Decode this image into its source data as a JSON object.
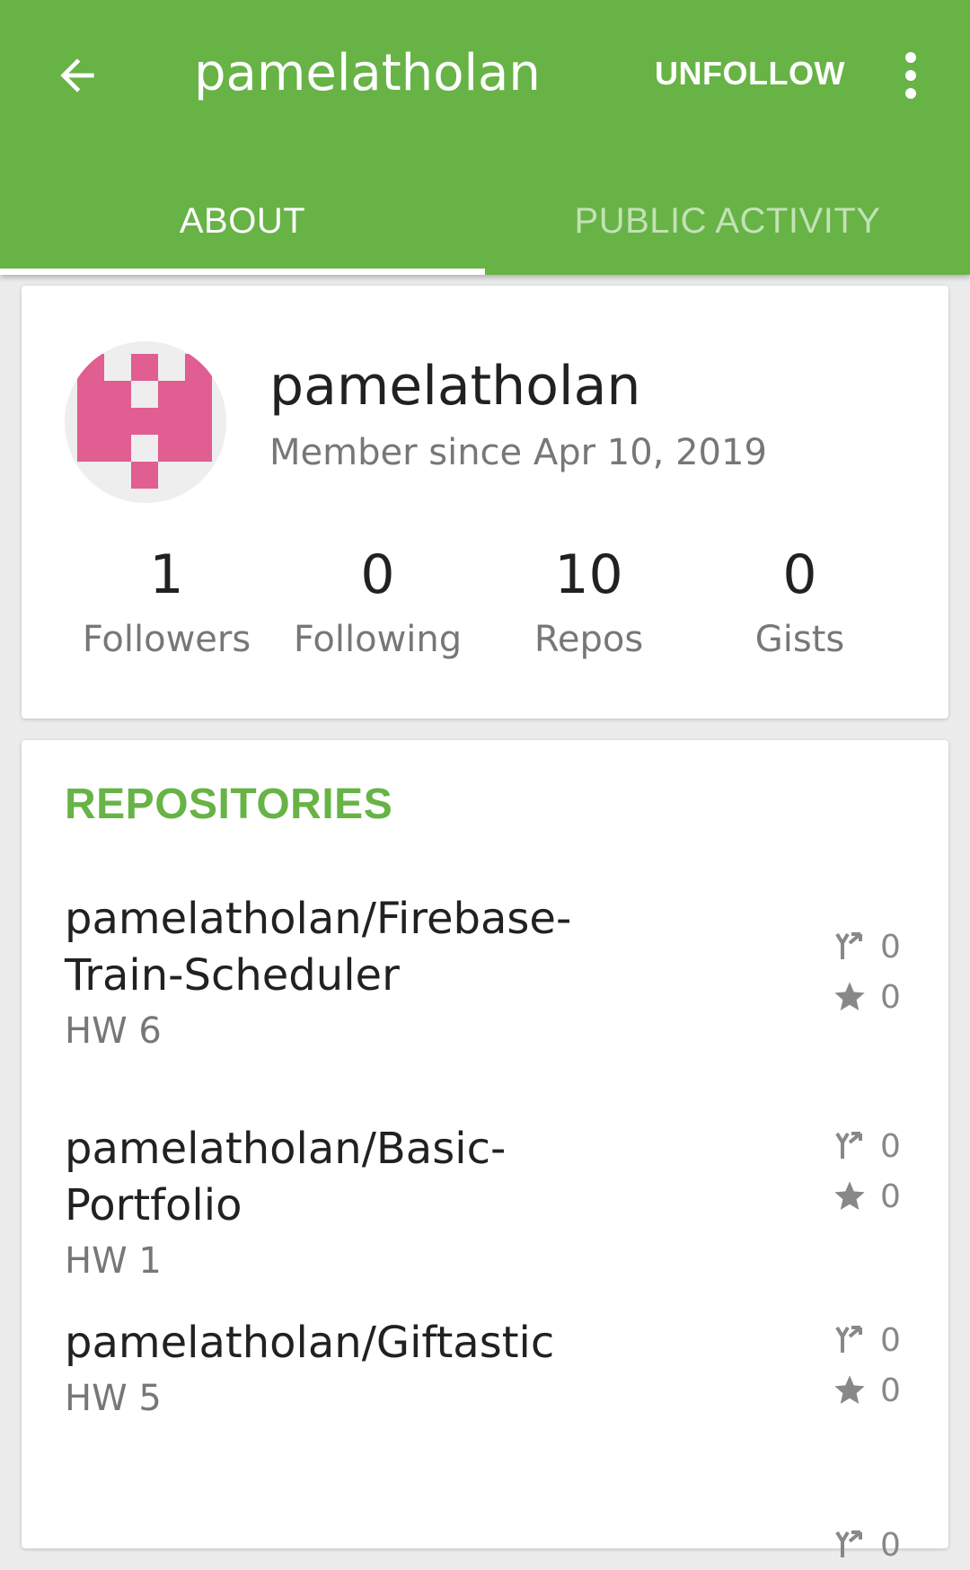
{
  "appbar": {
    "title": "pamelatholan",
    "unfollow_label": "UNFOLLOW",
    "background": "#67b346"
  },
  "tabs": [
    {
      "label": "ABOUT",
      "active": true
    },
    {
      "label": "PUBLIC ACTIVITY",
      "active": false
    }
  ],
  "profile": {
    "username": "pamelatholan",
    "member_since": "Member since Apr 10, 2019",
    "avatar_color": "#e05e91",
    "stats": [
      {
        "value": "1",
        "label": "Followers"
      },
      {
        "value": "0",
        "label": "Following"
      },
      {
        "value": "10",
        "label": "Repos"
      },
      {
        "value": "0",
        "label": "Gists"
      }
    ]
  },
  "repositories": {
    "header": "REPOSITORIES",
    "items": [
      {
        "name": "pamelatholan/Firebase-Train-Scheduler",
        "description": "HW 6",
        "forks": "0",
        "stars": "0"
      },
      {
        "name": "pamelatholan/Basic-Portfolio",
        "description": "HW 1",
        "forks": "0",
        "stars": "0"
      },
      {
        "name": "pamelatholan/Giftastic",
        "description": "HW 5",
        "forks": "0",
        "stars": "0"
      },
      {
        "name": "",
        "description": "",
        "forks": "0",
        "stars": ""
      }
    ]
  }
}
